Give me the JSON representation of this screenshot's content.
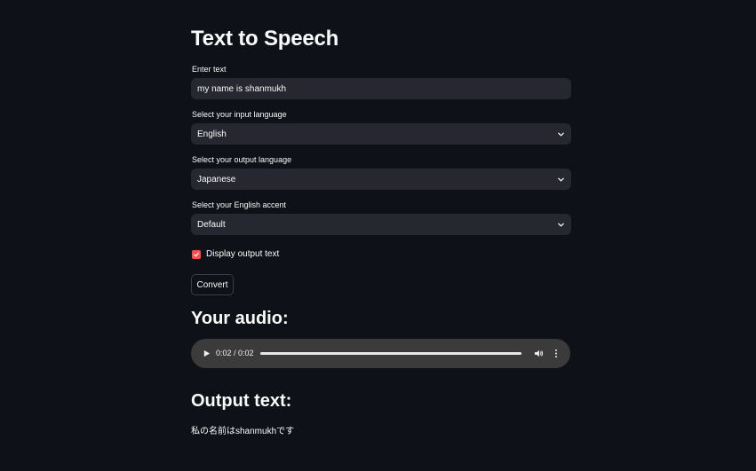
{
  "app": {
    "title": "Text to Speech"
  },
  "form": {
    "text_label": "Enter text",
    "text_value": "my name is shanmukh",
    "input_lang_label": "Select your input language",
    "input_lang_value": "English",
    "output_lang_label": "Select your output language",
    "output_lang_value": "Japanese",
    "accent_label": "Select your English accent",
    "accent_value": "Default",
    "display_output_label": "Display output text",
    "display_output_checked": true,
    "convert_label": "Convert"
  },
  "audio": {
    "heading": "Your audio:",
    "time": "0:02 / 0:02",
    "progress": 1.0
  },
  "output": {
    "heading": "Output text:",
    "text": "私の名前はshanmukhです"
  },
  "colors": {
    "background": "#0e1117",
    "widget": "#262730",
    "accent": "#ff4b4b",
    "text": "#fafafa"
  },
  "icons": {
    "select_chevron": "chevron-down-icon",
    "checkbox": "check-icon",
    "audio_play": "play-icon",
    "audio_volume": "volume-icon",
    "audio_more": "more-vertical-icon"
  }
}
